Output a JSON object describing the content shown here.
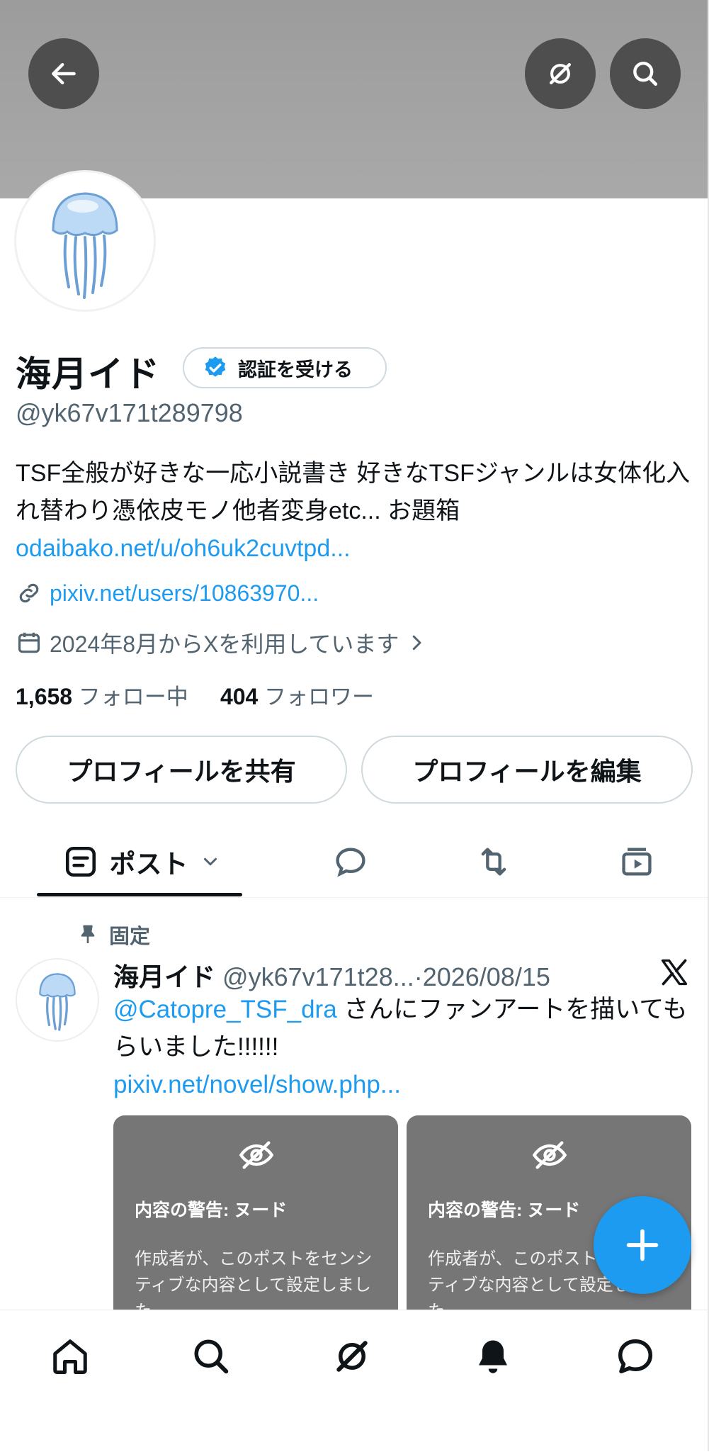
{
  "profile": {
    "name": "海月イド",
    "verify_label": "認証を受ける",
    "handle": "@yk67v171t289798",
    "bio_text": "TSF全般が好きな一応小説書き 好きなTSFジャンルは女体化入れ替わり憑依皮モノ他者変身etc... お題箱",
    "bio_link": "odaibako.net/u/oh6uk2cuvtpd...",
    "website": "pixiv.net/users/10863970...",
    "joined": "2024年8月からXを利用しています",
    "following_count": "1,658",
    "following_label": "フォロー中",
    "followers_count": "404",
    "followers_label": "フォロワー"
  },
  "buttons": {
    "share": "プロフィールを共有",
    "edit": "プロフィールを編集"
  },
  "tabs": {
    "posts": "ポスト"
  },
  "post": {
    "pinned_label": "固定",
    "author_name": "海月イド",
    "author_handle": "@yk67v171t28...",
    "date": "·2026/08/15",
    "mention": "@Catopre_TSF_dra",
    "text": " さんにファンアートを描いてもらいました!!!!!!",
    "link": "pixiv.net/novel/show.php...",
    "media": [
      {
        "warning_title": "内容の警告: ヌード",
        "warning_body": "作成者が、このポストをセンシティブな内容として設定しました。"
      },
      {
        "warning_title": "内容の警告: ヌード",
        "warning_body": "作成者が、このポストをセンシティブな内容として設定しました。"
      }
    ]
  },
  "colors": {
    "accent": "#1d9bf0",
    "text": "#0f1419",
    "secondary": "#536471",
    "banner": "#a3a3a3"
  },
  "icons": {
    "back": "arrow-left-icon",
    "grok": "grok-icon",
    "search": "search-icon",
    "verified": "verified-badge-icon",
    "link": "link-icon",
    "calendar": "calendar-icon",
    "pin": "pin-icon",
    "x": "x-logo-icon"
  }
}
